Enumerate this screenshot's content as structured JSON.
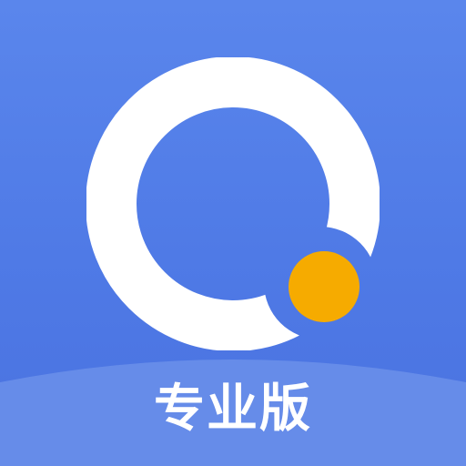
{
  "icon": {
    "edition_label": "专业版",
    "logo_name": "q-magnifier-logo-icon",
    "colors": {
      "background_top": "#5a86ec",
      "background_bottom": "#4a72e0",
      "band": "#6b90ea",
      "ring": "#ffffff",
      "dot": "#f6ab00",
      "label": "#ffffff"
    }
  }
}
